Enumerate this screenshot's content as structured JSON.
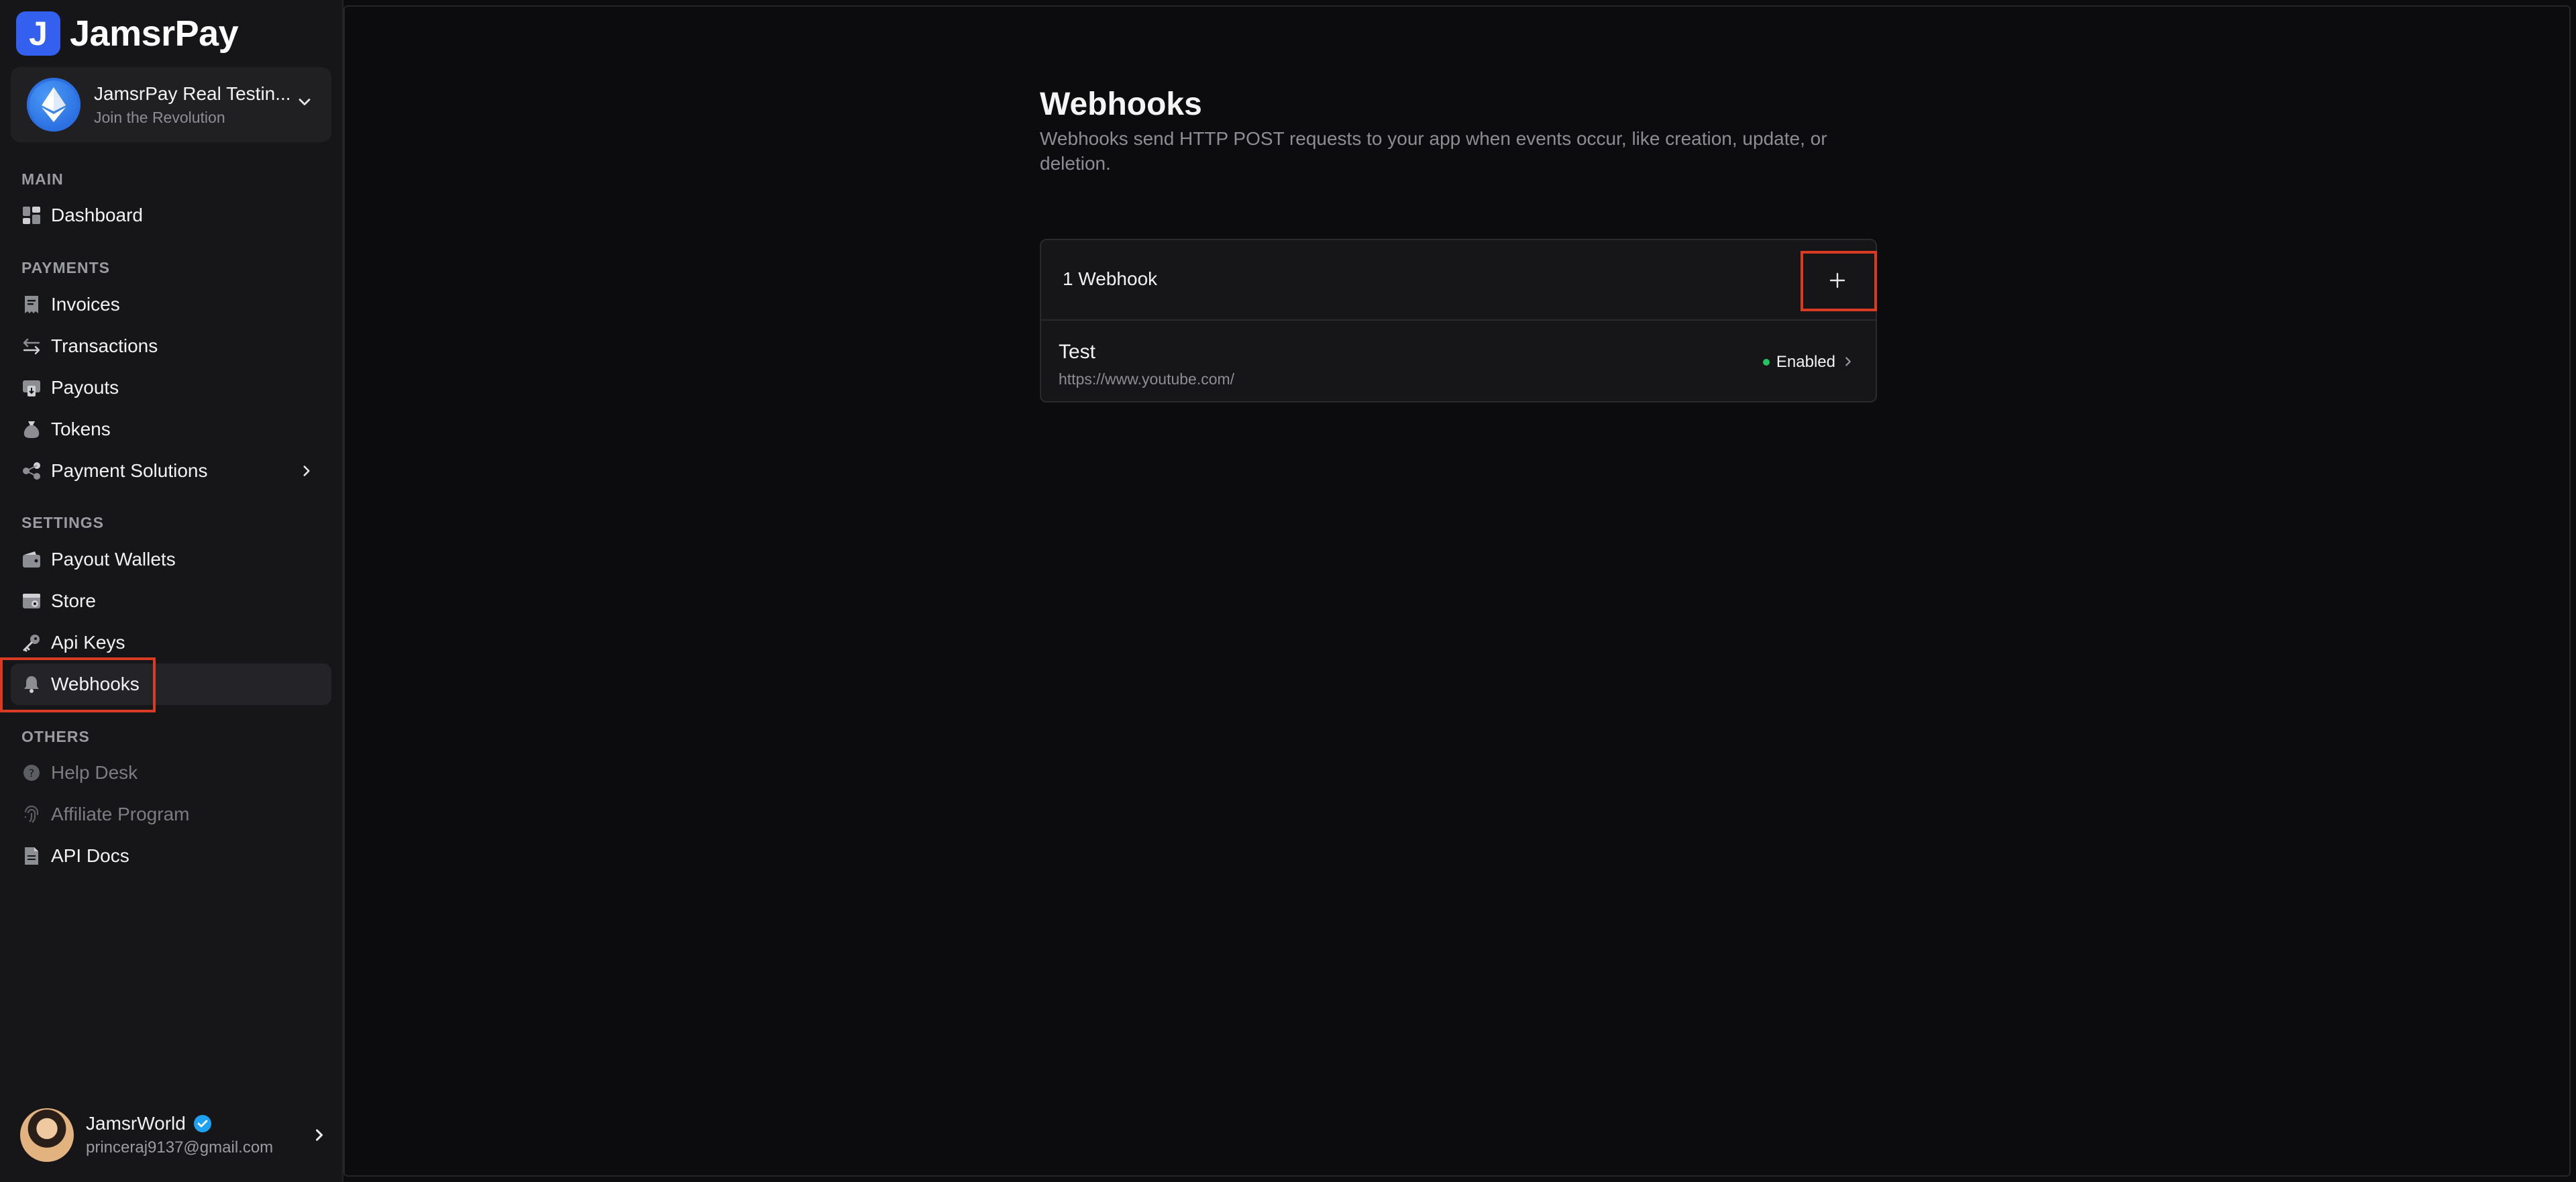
{
  "brand": {
    "logo_letter": "J",
    "name": "JamsrPay",
    "accent": "#3460f0"
  },
  "store": {
    "name": "JamsrPay Real Testin...",
    "subtitle": "Join the Revolution"
  },
  "sections": {
    "main": "MAIN",
    "payments": "PAYMENTS",
    "settings": "SETTINGS",
    "others": "OTHERS"
  },
  "nav": {
    "dashboard": "Dashboard",
    "invoices": "Invoices",
    "transactions": "Transactions",
    "payouts": "Payouts",
    "tokens": "Tokens",
    "payment_solutions": "Payment Solutions",
    "payout_wallets": "Payout Wallets",
    "store": "Store",
    "api_keys": "Api Keys",
    "webhooks": "Webhooks",
    "help_desk": "Help Desk",
    "affiliate_program": "Affiliate Program",
    "api_docs": "API Docs"
  },
  "user": {
    "name": "JamsrWorld",
    "email": "princeraj9137@gmail.com",
    "verified": true
  },
  "page": {
    "title": "Webhooks",
    "description": "Webhooks send HTTP POST requests to your app when events occur, like creation, update, or deletion."
  },
  "webhooks_card": {
    "count_label": "1 Webhook",
    "add_button": "+",
    "items": [
      {
        "name": "Test",
        "url": "https://www.youtube.com/",
        "status": "Enabled",
        "status_color": "#22c55e"
      }
    ]
  },
  "colors": {
    "highlight": "#d93a24",
    "background": "#0c0c0e",
    "sidebar": "#161618"
  }
}
